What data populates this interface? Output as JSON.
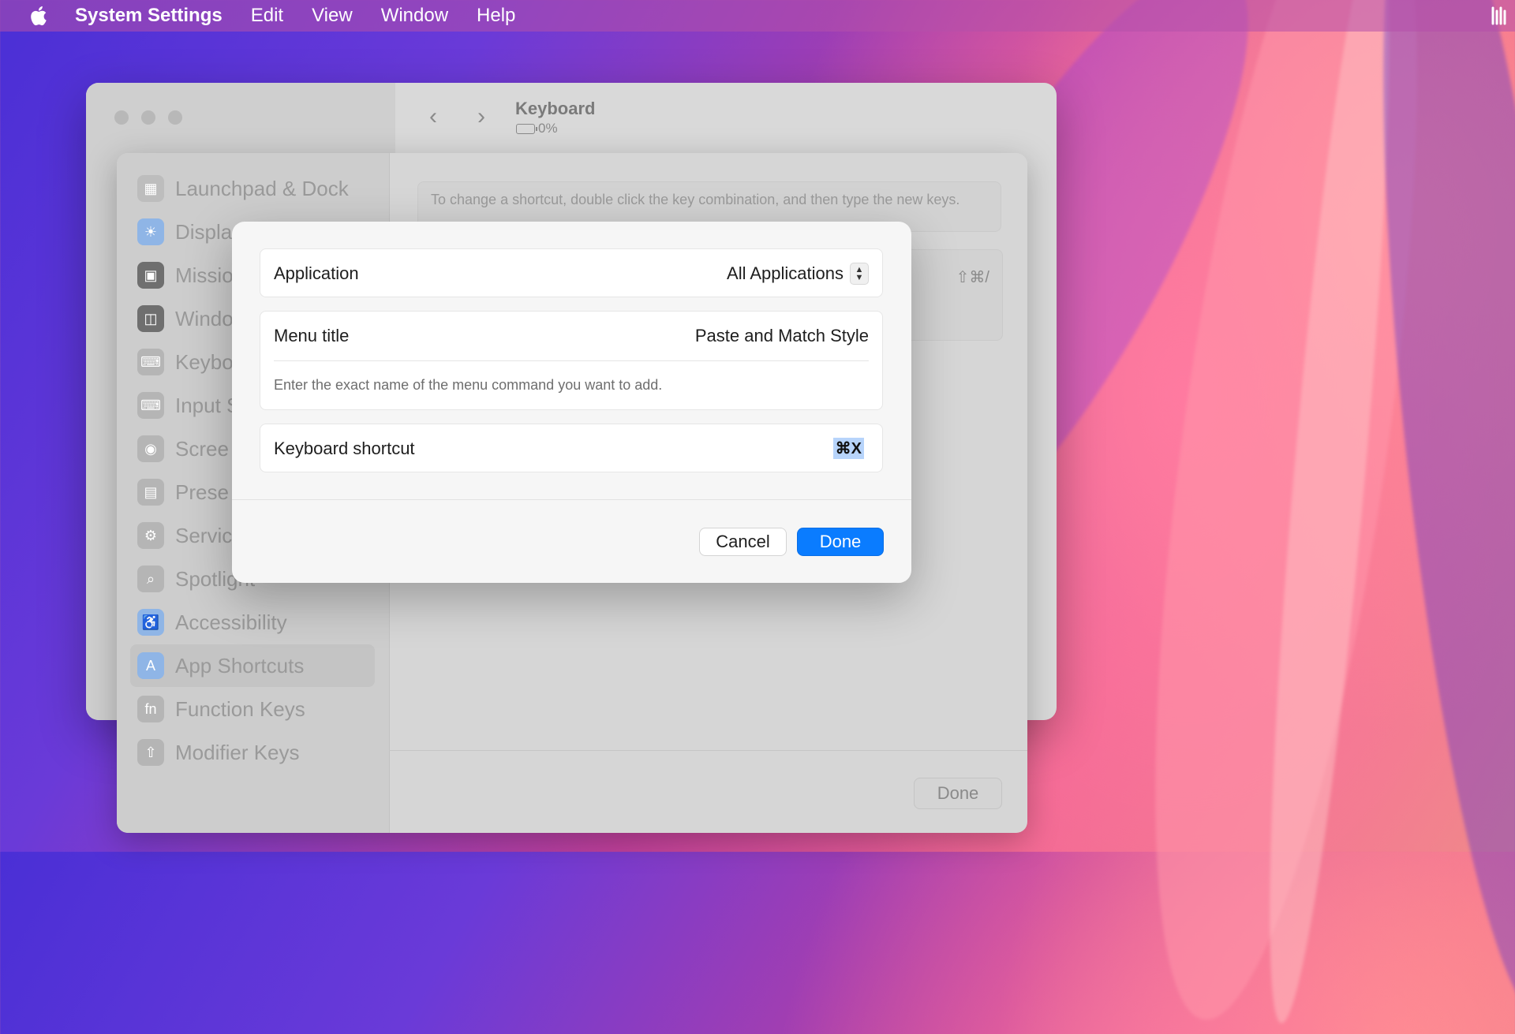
{
  "menubar": {
    "app_name": "System Settings",
    "items": [
      "Edit",
      "View",
      "Window",
      "Help"
    ]
  },
  "window": {
    "title": "Keyboard",
    "battery": "0%"
  },
  "sidebar": {
    "items": [
      {
        "label": "Launchpad & Dock",
        "icon": "launchpad-icon"
      },
      {
        "label": "Displa",
        "icon": "display-icon"
      },
      {
        "label": "Missio",
        "icon": "mission-control-icon"
      },
      {
        "label": "Windo",
        "icon": "window-icon"
      },
      {
        "label": "Keybo",
        "icon": "keyboard-icon"
      },
      {
        "label": "Input S",
        "icon": "input-icon"
      },
      {
        "label": "Scree",
        "icon": "screenshot-icon"
      },
      {
        "label": "Prese",
        "icon": "presenter-icon"
      },
      {
        "label": "Servic",
        "icon": "services-icon"
      },
      {
        "label": "Spotlight",
        "icon": "spotlight-icon"
      },
      {
        "label": "Accessibility",
        "icon": "accessibility-icon"
      },
      {
        "label": "App Shortcuts",
        "icon": "app-shortcuts-icon"
      },
      {
        "label": "Function Keys",
        "icon": "function-keys-icon"
      },
      {
        "label": "Modifier Keys",
        "icon": "modifier-keys-icon"
      }
    ]
  },
  "panel": {
    "info_text": "To change a shortcut, double click the key combination, and then type the new keys.",
    "existing_shortcut": "⇧⌘/",
    "done_label": "Done"
  },
  "dialog": {
    "application_label": "Application",
    "application_value": "All Applications",
    "menu_title_label": "Menu title",
    "menu_title_value": "Paste and Match Style",
    "menu_title_hint": "Enter the exact name of the menu command you want to add.",
    "shortcut_label": "Keyboard shortcut",
    "shortcut_value": "⌘X",
    "cancel_label": "Cancel",
    "done_label": "Done"
  },
  "colors": {
    "accent": "#0a7cff",
    "selection": "#b7d4fb"
  }
}
